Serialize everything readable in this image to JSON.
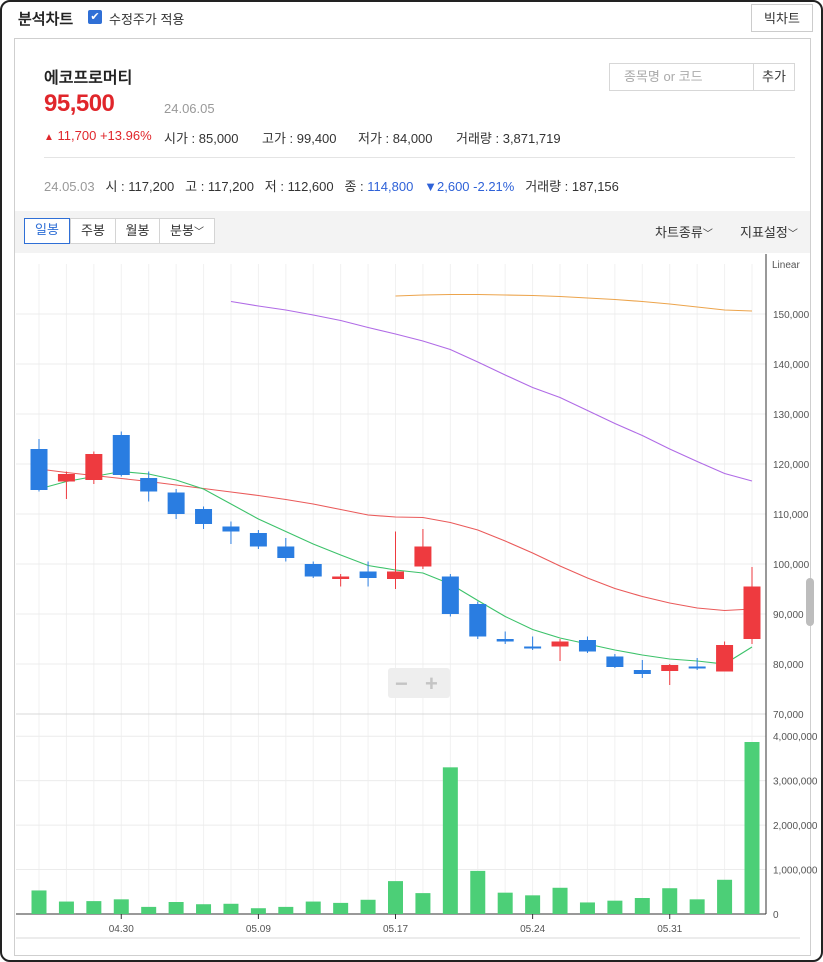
{
  "header": {
    "title": "분석차트",
    "adjusted_checkbox_label": "수정주가 적용",
    "big_chart_button": "빅차트"
  },
  "stock": {
    "name": "에코프로머티",
    "price": "95,500",
    "date": "24.06.05",
    "change_arrow": "▲",
    "change": "11,700 +13.96%",
    "open": "시가 : 85,000",
    "high": "고가 : 99,400",
    "low": "저가 : 84,000",
    "volume": "거래량 : 3,871,719"
  },
  "search": {
    "placeholder": "종목명 or 코드",
    "add_button": "추가"
  },
  "prev_day": {
    "date": "24.05.03",
    "open": "시 : 117,200",
    "high": "고 : 117,200",
    "low": "저 : 112,600",
    "close_label": "종 : ",
    "close": "114,800",
    "change": "▼2,600 -2.21%",
    "volume": "거래량 : 187,156"
  },
  "toolbar": {
    "tabs": [
      "일봉",
      "주봉",
      "월봉",
      "분봉"
    ],
    "active_tab": "일봉",
    "chart_type_menu": "차트종류",
    "indicator_menu": "지표설정",
    "dropdown_glyph": "﹀"
  },
  "colors": {
    "up": "#ee3a3f",
    "down": "#2a7de1",
    "ma5": "#3cc26a",
    "ma20": "#ea5a5a",
    "ma60": "#b06be6",
    "ma120": "#eca44c",
    "volume": "#4ccf77"
  },
  "chart_data": {
    "type": "candlestick",
    "price_scale_label": "Linear",
    "price_ylim": [
      70000,
      160000
    ],
    "price_ticks": [
      "70,000",
      "80,000",
      "90,000",
      "100,000",
      "110,000",
      "120,000",
      "130,000",
      "140,000",
      "150,000"
    ],
    "volume_ylim": [
      0,
      4500000
    ],
    "volume_ticks": [
      "0",
      "1,000,000",
      "2,000,000",
      "3,000,000",
      "4,000,000"
    ],
    "x_labels": [
      {
        "index": 3,
        "label": "04.30"
      },
      {
        "index": 8,
        "label": "05.09"
      },
      {
        "index": 13,
        "label": "05.17"
      },
      {
        "index": 18,
        "label": "05.24"
      },
      {
        "index": 23,
        "label": "05.31"
      }
    ],
    "candles": [
      {
        "o": 123000,
        "h": 125000,
        "l": 114500,
        "c": 114800
      },
      {
        "o": 116500,
        "h": 118500,
        "l": 113000,
        "c": 118000
      },
      {
        "o": 116800,
        "h": 122500,
        "l": 116000,
        "c": 122000
      },
      {
        "o": 125800,
        "h": 126500,
        "l": 117500,
        "c": 117800
      },
      {
        "o": 117200,
        "h": 118500,
        "l": 112500,
        "c": 114500
      },
      {
        "o": 114300,
        "h": 115000,
        "l": 109000,
        "c": 110000
      },
      {
        "o": 111000,
        "h": 111500,
        "l": 107000,
        "c": 108000
      },
      {
        "o": 107500,
        "h": 108500,
        "l": 104000,
        "c": 106500
      },
      {
        "o": 106200,
        "h": 106800,
        "l": 103000,
        "c": 103500
      },
      {
        "o": 103500,
        "h": 105200,
        "l": 100500,
        "c": 101200
      },
      {
        "o": 100000,
        "h": 100500,
        "l": 97200,
        "c": 97500
      },
      {
        "o": 97000,
        "h": 98000,
        "l": 95500,
        "c": 97500
      },
      {
        "o": 98500,
        "h": 100500,
        "l": 95500,
        "c": 97200
      },
      {
        "o": 97000,
        "h": 106500,
        "l": 95000,
        "c": 98500
      },
      {
        "o": 99500,
        "h": 107000,
        "l": 99000,
        "c": 103500
      },
      {
        "o": 97500,
        "h": 98000,
        "l": 89500,
        "c": 90000
      },
      {
        "o": 92000,
        "h": 92500,
        "l": 85000,
        "c": 85500
      },
      {
        "o": 85000,
        "h": 86500,
        "l": 84000,
        "c": 84500
      },
      {
        "o": 83500,
        "h": 85500,
        "l": 82800,
        "c": 83200
      },
      {
        "o": 83500,
        "h": 85000,
        "l": 80600,
        "c": 84500
      },
      {
        "o": 84800,
        "h": 85500,
        "l": 82200,
        "c": 82500
      },
      {
        "o": 81500,
        "h": 82000,
        "l": 79200,
        "c": 79400
      },
      {
        "o": 78800,
        "h": 80800,
        "l": 77200,
        "c": 78000
      },
      {
        "o": 78600,
        "h": 80000,
        "l": 75800,
        "c": 79800
      },
      {
        "o": 79500,
        "h": 81200,
        "l": 78800,
        "c": 79200
      },
      {
        "o": 78500,
        "h": 84500,
        "l": 78500,
        "c": 83800
      },
      {
        "o": 85000,
        "h": 99400,
        "l": 84000,
        "c": 95500
      }
    ],
    "volumes": [
      530000,
      280000,
      290000,
      330000,
      160000,
      270000,
      220000,
      230000,
      130000,
      160000,
      280000,
      250000,
      320000,
      740000,
      470000,
      3300000,
      970000,
      480000,
      420000,
      590000,
      260000,
      300000,
      360000,
      580000,
      330000,
      770000,
      3870000
    ],
    "moving_averages": {
      "ma5": [
        115000,
        116500,
        117500,
        118500,
        118000,
        116800,
        115000,
        112000,
        109000,
        106500,
        104000,
        101800,
        99700,
        98800,
        98200,
        96000,
        92700,
        89500,
        86900,
        85200,
        84000,
        82800,
        81800,
        81000,
        80600,
        80000,
        83400
      ],
      "ma20": [
        119000,
        118300,
        117700,
        117100,
        116500,
        115800,
        115100,
        114400,
        113700,
        112900,
        112000,
        110900,
        109800,
        109400,
        109300,
        108300,
        106800,
        104600,
        102200,
        99600,
        97200,
        95100,
        93500,
        92200,
        91200,
        90700,
        91000
      ],
      "ma60": [
        152500,
        151600,
        150800,
        149800,
        148700,
        147300,
        146000,
        144600,
        142900,
        140400,
        137800,
        135300,
        133300,
        130700,
        128100,
        125700,
        123000,
        120500,
        118100,
        116600
      ],
      "ma120": [
        153600,
        153800,
        153900,
        153900,
        153800,
        153700,
        153500,
        153200,
        152900,
        152500,
        152000,
        151400,
        150800,
        150600
      ]
    }
  }
}
